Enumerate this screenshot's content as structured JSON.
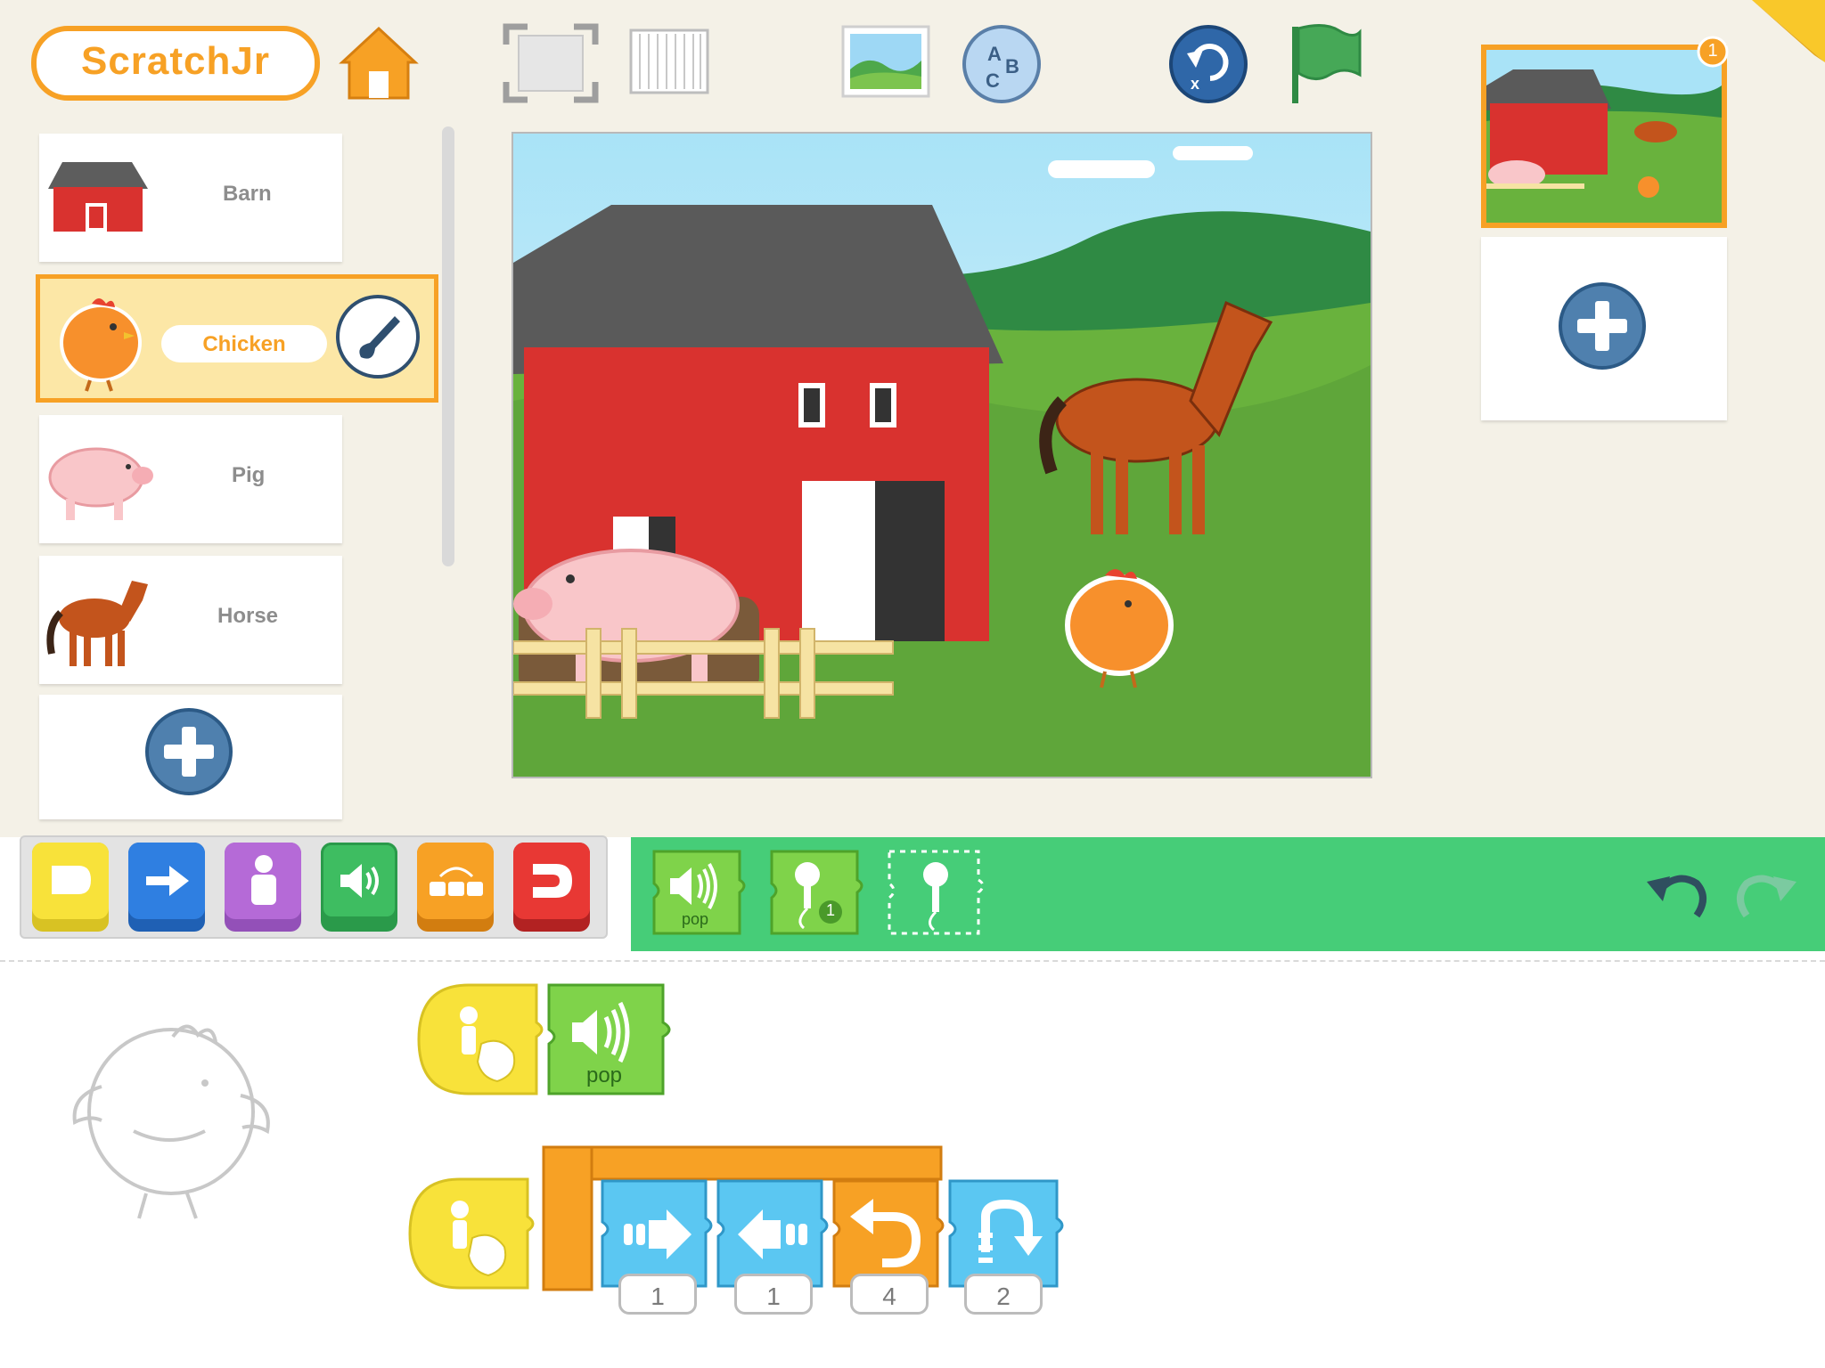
{
  "app": {
    "logo_text": "ScratchJr",
    "brand_orange": "#f7a125",
    "stage_page_badge": "1"
  },
  "sprites": [
    {
      "name": "Barn",
      "selected": false
    },
    {
      "name": "Chicken",
      "selected": true
    },
    {
      "name": "Pig",
      "selected": false
    },
    {
      "name": "Horse",
      "selected": false
    }
  ],
  "palette": {
    "category_colors": [
      "#f8e23a",
      "#2f7fe1",
      "#b56ad7",
      "#3ebd61",
      "#f7a125",
      "#e83834"
    ],
    "green_bar_color": "#46cd78",
    "blocks": [
      {
        "icon": "speaker-icon",
        "label": "pop"
      },
      {
        "icon": "microphone-icon",
        "label": "1"
      },
      {
        "icon": "record-microphone-icon",
        "label": ""
      }
    ]
  },
  "scripts": [
    {
      "blocks": [
        {
          "type": "start-on-tap",
          "label": ""
        },
        {
          "type": "play-sound",
          "label": "pop"
        }
      ]
    },
    {
      "blocks": [
        {
          "type": "start-on-tap",
          "label": ""
        },
        {
          "type": "move-right",
          "value": "1"
        },
        {
          "type": "move-left",
          "value": "1"
        },
        {
          "type": "turn-left",
          "value": "4"
        },
        {
          "type": "hop",
          "value": "2"
        }
      ]
    }
  ]
}
